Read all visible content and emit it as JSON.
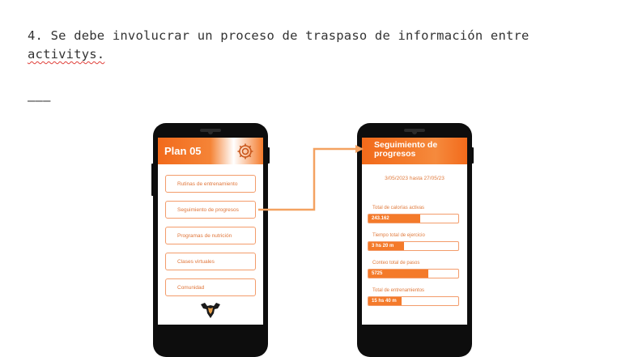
{
  "doc": {
    "line1": "4. Se debe involucrar un proceso de traspaso de información entre",
    "line2_plain": "activitys.",
    "hr": "———"
  },
  "phone1": {
    "title": "Plan 05",
    "icon": "gear-icon",
    "menu": [
      "Rutinas de entrenamiento",
      "Seguimiento de progresos",
      "Programas de nutrición",
      "Clases virtuales",
      "Comunidad"
    ],
    "logo": "muscle-logo"
  },
  "phone2": {
    "title": "Seguimiento de progresos",
    "date_range": "3/05/2023 hasta 27/05/23",
    "stats": [
      {
        "label": "Total de calorías activas",
        "value": "243.162",
        "fill": 0.58
      },
      {
        "label": "Tiempo total de ejercicio",
        "value": "3 hs 20 m",
        "fill": 0.4
      },
      {
        "label": "Conteo total de pasos",
        "value": "5725",
        "fill": 0.67
      },
      {
        "label": "Total de entrenamientos",
        "value": "15 hs 40 m",
        "fill": 0.37
      }
    ]
  },
  "colors": {
    "accent": "#f47a2a",
    "accent_light": "#f39c6b",
    "text_accent": "#e07a3c",
    "arrow": "#f4a261"
  }
}
